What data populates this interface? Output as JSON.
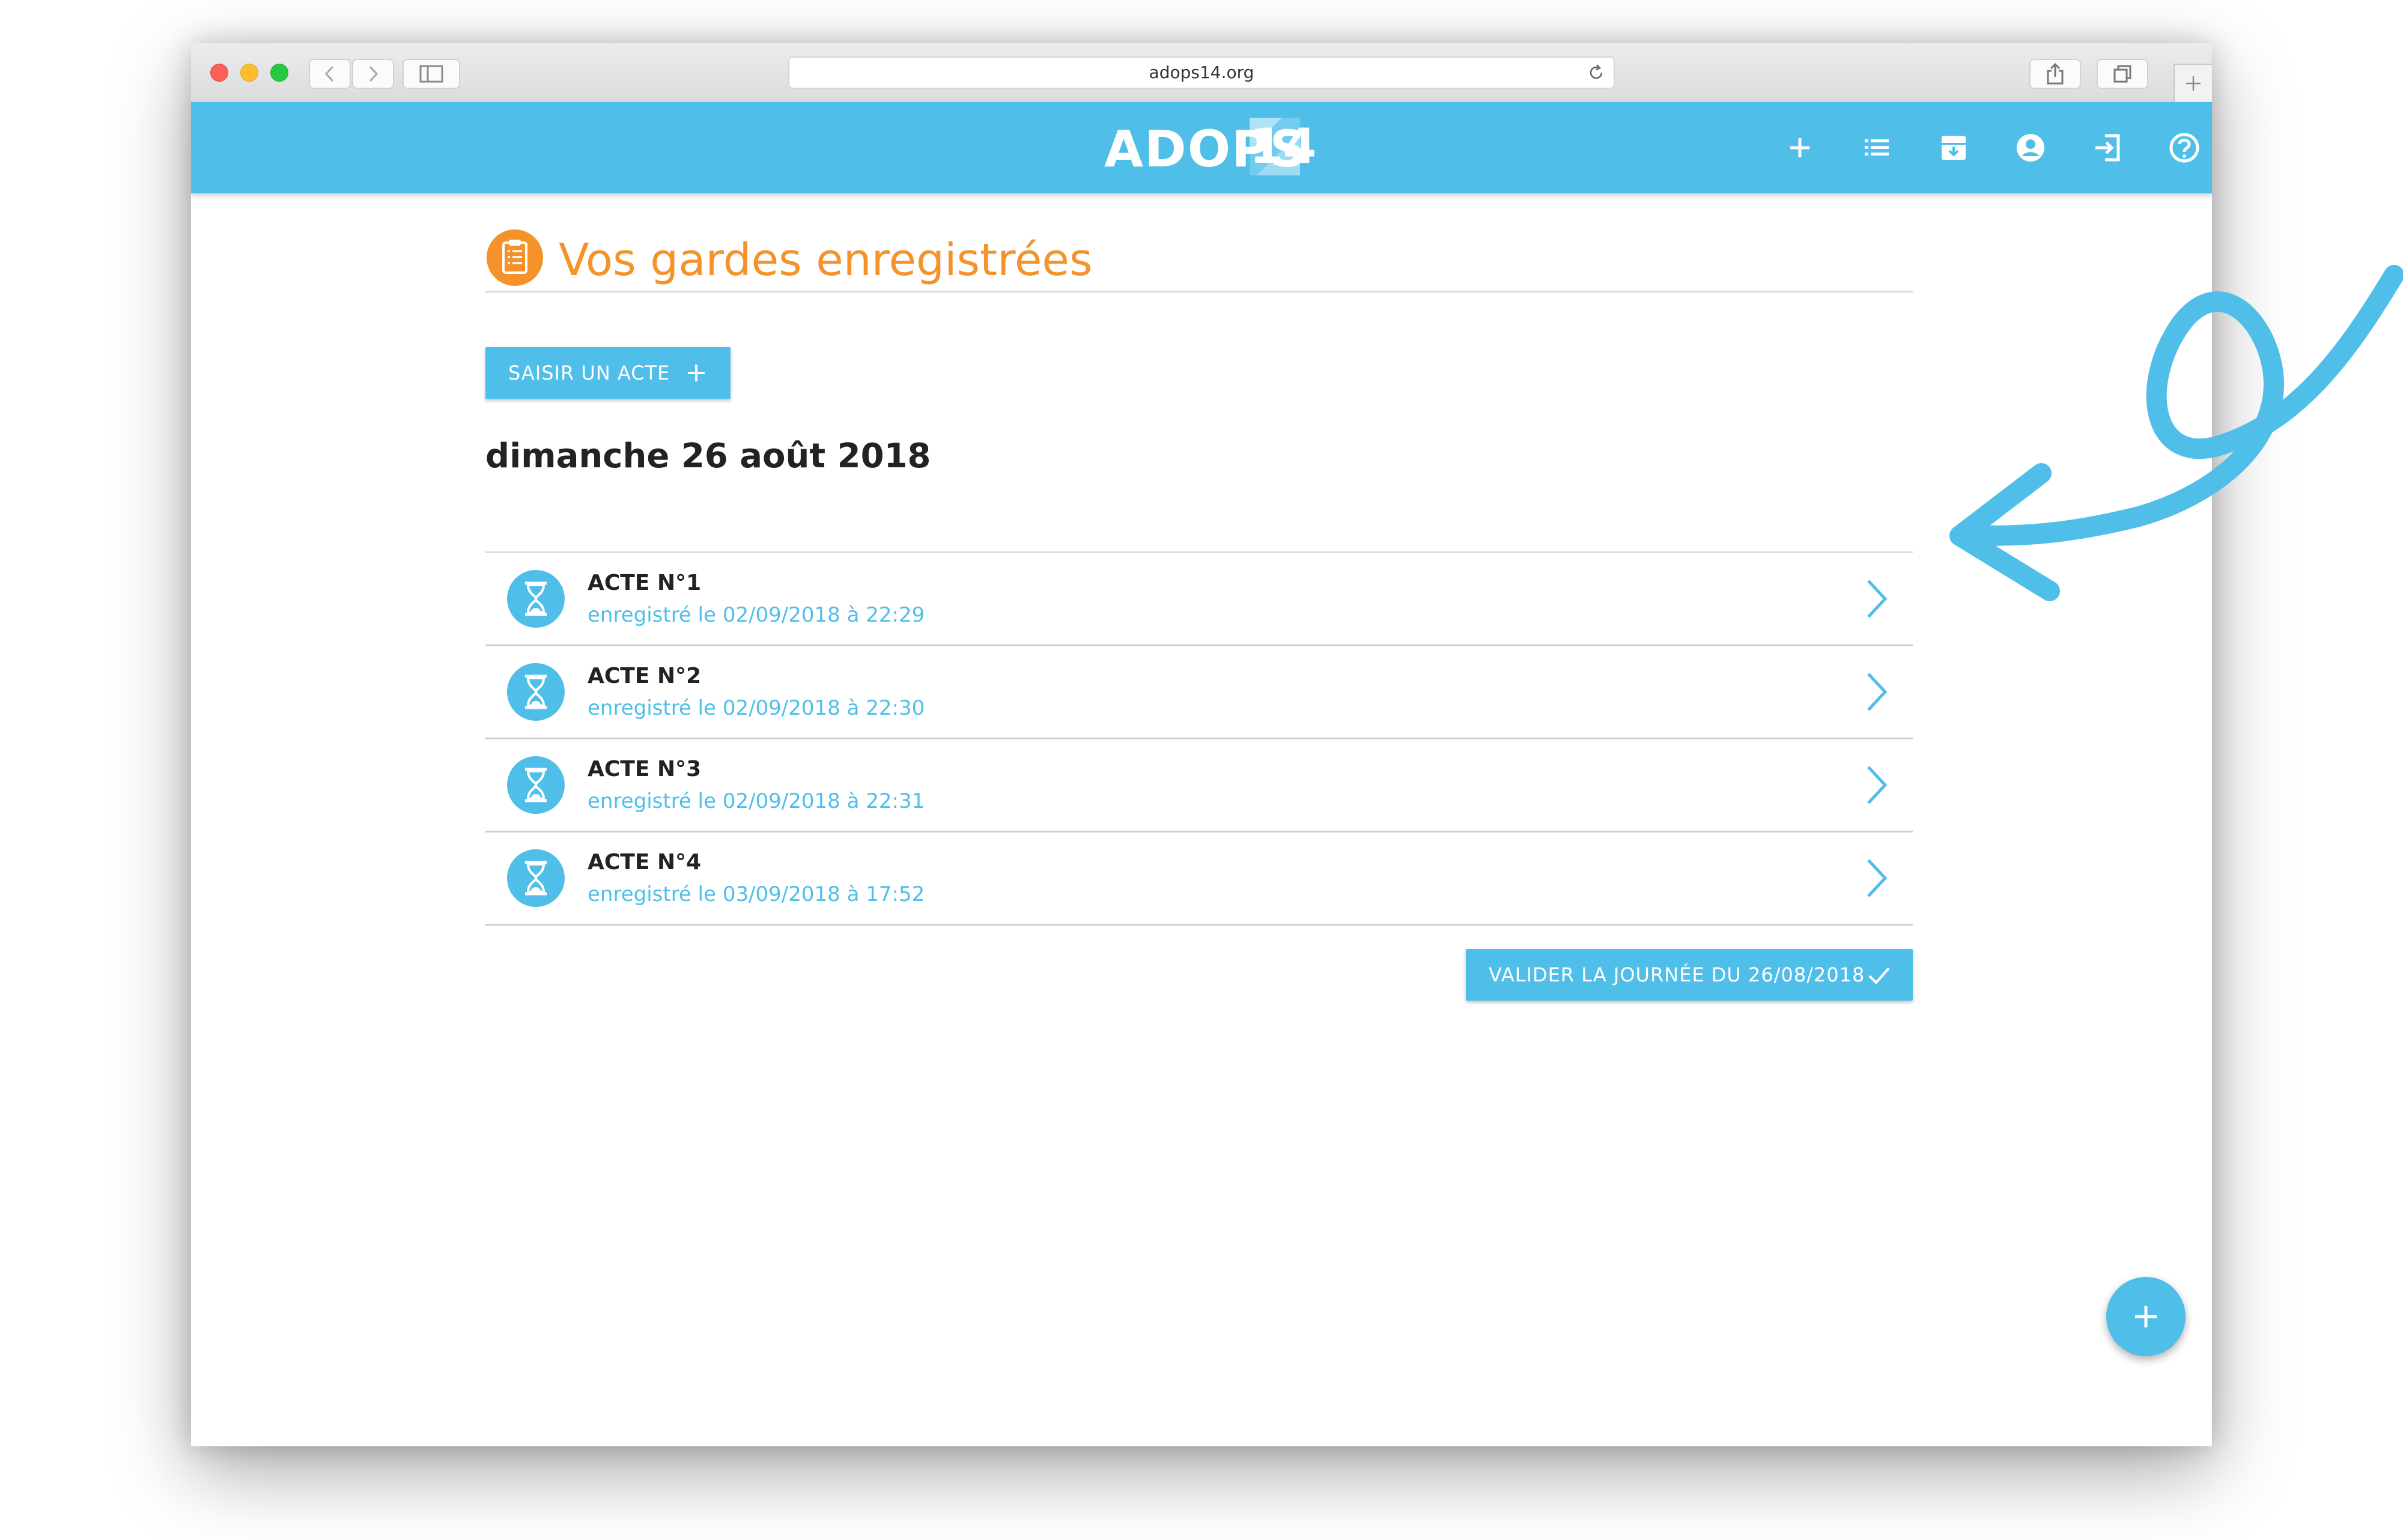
{
  "browser": {
    "url": "adops14.org"
  },
  "app": {
    "logo_text": "ADOPS",
    "logo_number": "14",
    "nav_icons": [
      "plus-icon",
      "list-icon",
      "archive-icon",
      "account-icon",
      "logout-icon",
      "help-icon"
    ]
  },
  "page": {
    "title": "Vos gardes enregistrées",
    "saisir_button_label": "SAISIR UN ACTE",
    "day_heading": "dimanche 26 août 2018",
    "valider_button_label": "VALIDER LA JOURNÉE DU 26/08/2018"
  },
  "actes": [
    {
      "title": "ACTE N°1",
      "subtitle": "enregistré le 02/09/2018 à 22:29"
    },
    {
      "title": "ACTE N°2",
      "subtitle": "enregistré le 02/09/2018 à 22:30"
    },
    {
      "title": "ACTE N°3",
      "subtitle": "enregistré le 02/09/2018 à 22:31"
    },
    {
      "title": "ACTE N°4",
      "subtitle": "enregistré le 03/09/2018 à 17:52"
    }
  ],
  "colors": {
    "primary": "#4fbfe9",
    "accent": "#f5932a"
  }
}
